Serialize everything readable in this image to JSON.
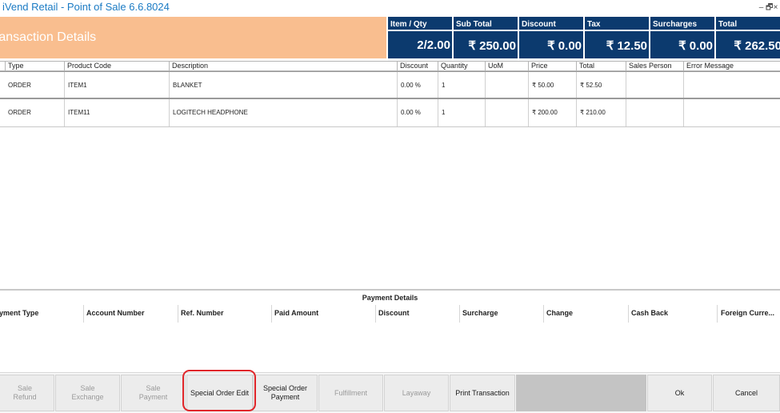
{
  "window": {
    "title": "iVend Retail - Point of Sale 6.6.8024",
    "controls": [
      "–",
      "🗗",
      "×"
    ]
  },
  "header": {
    "title": "ransaction Details",
    "totals": [
      {
        "label": "Item / Qty",
        "value": "2/2.00"
      },
      {
        "label": "Sub Total",
        "value": "₹ 250.00"
      },
      {
        "label": "Discount",
        "value": "₹ 0.00"
      },
      {
        "label": "Tax",
        "value": "₹ 12.50"
      },
      {
        "label": "Surcharges",
        "value": "₹ 0.00"
      },
      {
        "label": "Total",
        "value": "₹ 262.50"
      }
    ]
  },
  "items_table": {
    "columns": [
      "Type",
      "Product Code",
      "Description",
      "Discount",
      "Quantity",
      "UoM",
      "Price",
      "Total",
      "Sales Person",
      "Error Message"
    ],
    "rows": [
      [
        "ORDER",
        "ITEM1",
        "BLANKET",
        "0.00 %",
        "1",
        "",
        "₹ 50.00",
        "₹ 52.50",
        "",
        ""
      ],
      [
        "ORDER",
        "ITEM11",
        "LOGITECH HEADPHONE",
        "0.00 %",
        "1",
        "",
        "₹ 200.00",
        "₹ 210.00",
        "",
        ""
      ]
    ]
  },
  "payment": {
    "title": "Payment Details",
    "columns": [
      "yment Type",
      "Account Number",
      "Ref. Number",
      "Paid Amount",
      "Discount",
      "Surcharge",
      "Change",
      "Cash Back",
      "Foreign Curre..."
    ]
  },
  "buttons": [
    {
      "label": "Sale\nRefund",
      "enabled": false
    },
    {
      "label": "Sale\nExchange",
      "enabled": false
    },
    {
      "label": "Sale\nPayment",
      "enabled": false
    },
    {
      "label": "Special Order Edit",
      "enabled": true
    },
    {
      "label": "Special Order\nPayment",
      "enabled": true
    },
    {
      "label": "Fulfillment",
      "enabled": false
    },
    {
      "label": "Layaway",
      "enabled": false
    },
    {
      "label": "Print Transaction",
      "enabled": true
    },
    {
      "label": "Ok",
      "enabled": true
    },
    {
      "label": "Cancel",
      "enabled": true
    }
  ],
  "colors": {
    "title_text": "#1b7bc4",
    "header_orange": "#f9be8f",
    "totals_blue": "#0c3a6e",
    "highlight_red": "#e0262a"
  }
}
